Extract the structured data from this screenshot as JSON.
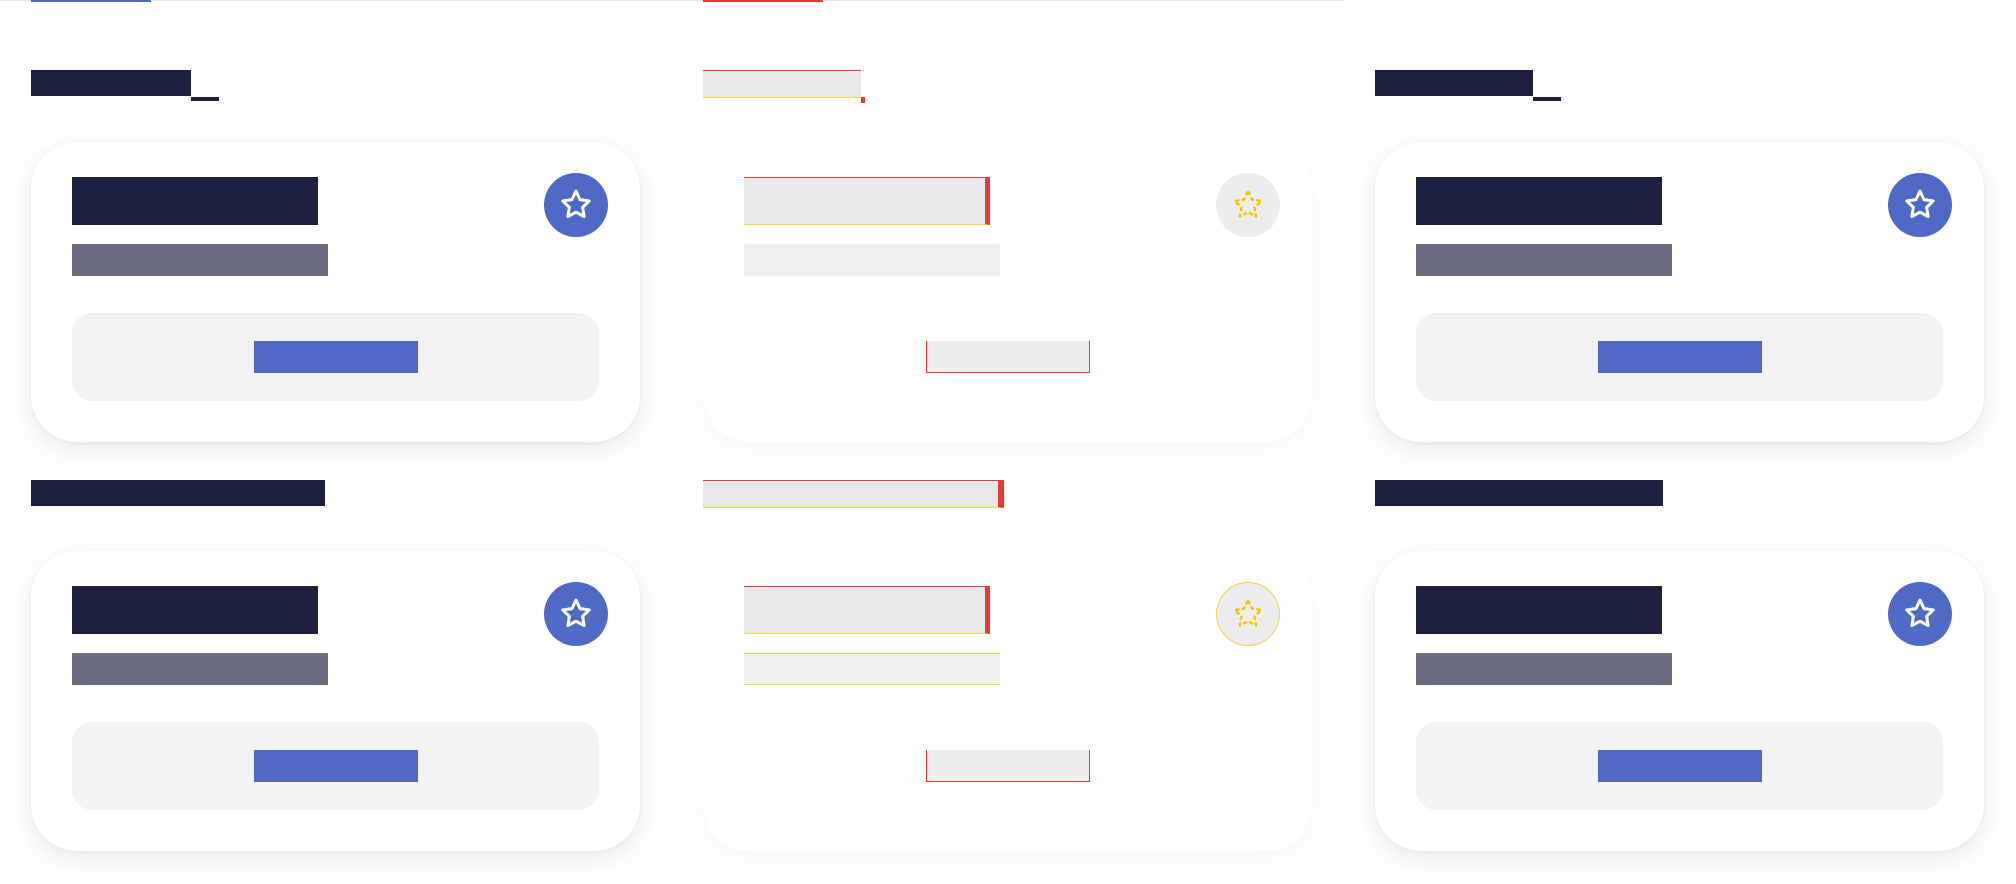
{
  "colors": {
    "accent": "#4f6ac6",
    "text_dark": "#1c1f3e",
    "text_muted": "#6b6c7e",
    "placeholder": "#e8e8ea",
    "placeholder_marker": "#e53935",
    "placeholder_warning": "#f2c400"
  },
  "panels": [
    {
      "state": "active",
      "sections": [
        {
          "heading": "",
          "card": {
            "title": "",
            "subtitle": "",
            "action_label": "",
            "favorite_icon": "star-icon",
            "favorited": false
          }
        },
        {
          "heading": "",
          "card": {
            "title": "",
            "subtitle": "",
            "action_label": "",
            "favorite_icon": "star-icon",
            "favorited": false
          }
        }
      ]
    },
    {
      "state": "placeholder",
      "sections": [
        {
          "heading": "",
          "card": {
            "title": "",
            "subtitle": "",
            "action_label": "",
            "favorite_icon": "star-icon",
            "favorited": false
          }
        },
        {
          "heading": "",
          "card": {
            "title": "",
            "subtitle": "",
            "action_label": "",
            "favorite_icon": "star-icon",
            "favorited": false
          }
        }
      ]
    },
    {
      "state": "active",
      "sections": [
        {
          "heading": "",
          "card": {
            "title": "",
            "subtitle": "",
            "action_label": "",
            "favorite_icon": "star-icon",
            "favorited": false
          }
        },
        {
          "heading": "",
          "card": {
            "title": "",
            "subtitle": "",
            "action_label": "",
            "favorite_icon": "star-icon",
            "favorited": false
          }
        }
      ]
    }
  ]
}
